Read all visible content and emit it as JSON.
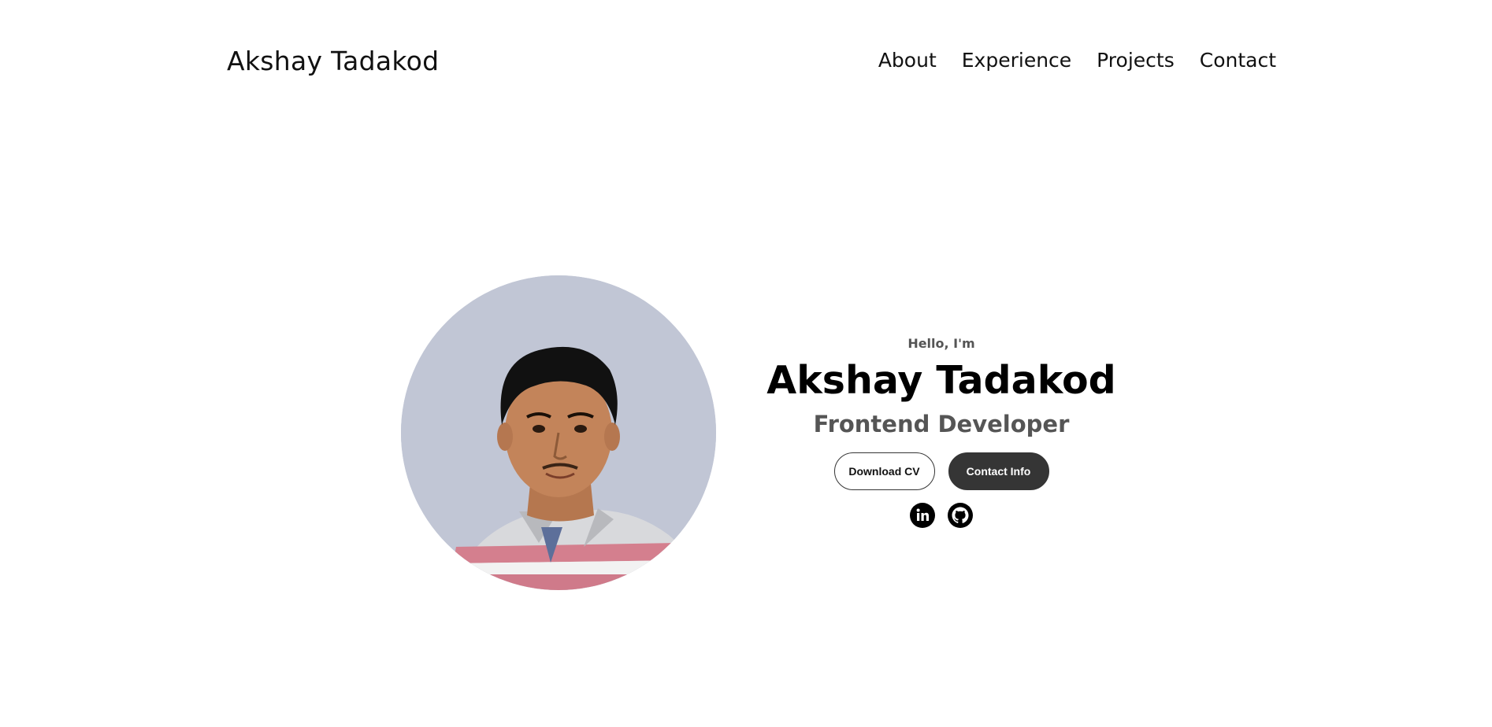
{
  "nav": {
    "logo": "Akshay Tadakod",
    "links": [
      "About",
      "Experience",
      "Projects",
      "Contact"
    ]
  },
  "profile": {
    "hello": "Hello, I'm",
    "name": "Akshay Tadakod",
    "role": "Frontend Developer",
    "buttons": {
      "download_cv": "Download CV",
      "contact_info": "Contact Info"
    },
    "socials": [
      "linkedin-icon",
      "github-icon"
    ]
  },
  "colors": {
    "photo_background": "#c1c6d5",
    "button_dark": "#353535",
    "subtitle_gray": "#555555"
  }
}
